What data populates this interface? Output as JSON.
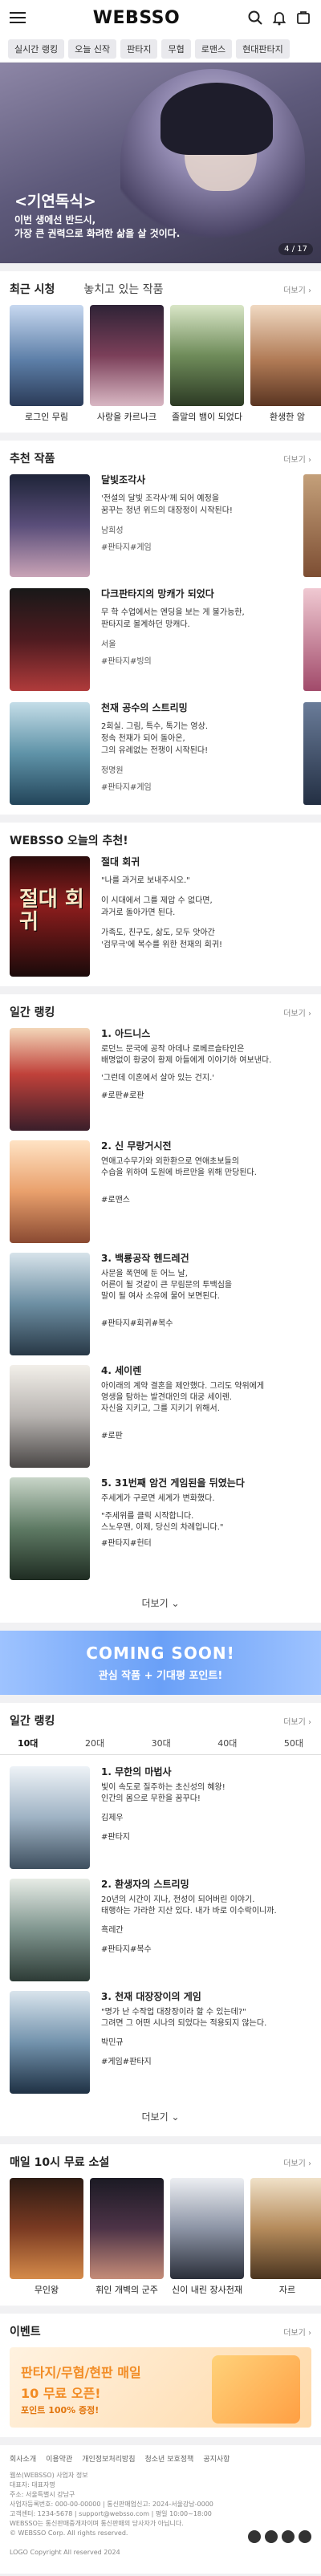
{
  "header": {
    "logo": "WEBSSO"
  },
  "categories": [
    "실시간 랭킹",
    "오늘 신작",
    "판타지",
    "무협",
    "로맨스",
    "현대판타지"
  ],
  "banner": {
    "title": "<기연독식>",
    "subtitle_line1": "이번 생에선 반드시,",
    "subtitle_line2": "가장 큰 권력으로 화려한 삶을 살 것이다.",
    "page": "4 / 17"
  },
  "recent": {
    "tab1": "최근 시청",
    "tab2": "놓치고 있는 작품",
    "more": "더보기 ›",
    "items": [
      "로그인 무림",
      "사랑을 카르나크",
      "졸말의 뱀이 되었다",
      "환생한 암"
    ]
  },
  "recommend": {
    "title": "추천 작품",
    "more": "더보기 ›",
    "items": [
      {
        "title": "달빛조각사",
        "desc": "'전설의 달빛 조각사'께 되어 예정을\n꿈꾸는 청년 위드의 대장정이 시작된다!",
        "author": "남희성",
        "tags": "#판타지#게임"
      },
      {
        "title": "다크판타지의 망캐가 되었다",
        "desc": "무 학 수업에서는 엔딩을 보는 게 불가능한,\n판타지로 볼계하던 망캐다.",
        "author": "서울",
        "tags": "#판타지#빙의"
      },
      {
        "title": "천재 공수의 스트리밍",
        "desc": "2회실. 그림, 특수, 톡기는 영상.\n정속 천재가 되어 돌아온,\n그의 유례없는 전쟁이 시작된다!",
        "author": "정명원",
        "tags": "#판타지#게임"
      }
    ]
  },
  "today": {
    "title": "WEBSSO 오늘의 추천!",
    "item": {
      "title": "절대 회귀",
      "l1": "\"나를 과거로 보내주시오.\"",
      "l2": "이 시대에서 그를 제압 수 없다면,",
      "l3": "과거로 돌아가면 된다.",
      "l4": "가족도, 친구도, 삶도, 모두 앗아간",
      "l5": "'검무극'에 복수를 위한 천재의 회귀!"
    }
  },
  "ranking": {
    "title": "일간 랭킹",
    "more": "더보기 ›",
    "more_button": "더보기",
    "items": [
      {
        "no": "1.",
        "title": "아드니스",
        "desc": "로던느 문국에 공작 아데나 로베르슬타인은\n배명없이 황궁이 황제 아들에게 이야기하 여보낸다.",
        "quote": "'그런데 이혼에서 살아 있는 건지.'",
        "tags": "#로판#로판"
      },
      {
        "no": "2.",
        "title": "신 무랑거시전",
        "desc": "연애고수무가와 외한환으로 연애초보들의\n수습을 위하여 도원에 바르만을 위해 만당된다.",
        "tags": "#로맨스"
      },
      {
        "no": "3.",
        "title": "백룡공작 헨드레건",
        "desc": "사문을 폭연에 둔 어느 날,\n어른이 될 것같이 큰 무림문의 투백심을\n말이 될 여사 소유에 물어 보면된다.",
        "tags": "#판타지#회귀#복수"
      },
      {
        "no": "4.",
        "title": "세이렌",
        "desc": "아이래의 계약 결혼을 제안했다. 그리도 약위에게\n영생을 탐하는 발견대인의 대궁 세이렌.\n자신을 지키고, 그를 지키기 위해서.",
        "tags": "#로판"
      },
      {
        "no": "5.",
        "title": "31번째 암건 게임된을 뒤였는다",
        "desc": "주세계가 구로면 세계가 변화했다.",
        "quote2": "\"주세위를 클릭 시작합니다.\n스노우맨, 이제, 당신의 차례입니다.\"",
        "tags": "#판타지#헌터"
      }
    ]
  },
  "coming": {
    "line1": "COMING SOON!",
    "line2": "관심 작품 + 기대평 포인트!"
  },
  "daily": {
    "title": "일간 랭킹",
    "more": "더보기 ›",
    "tabs": [
      "10대",
      "20대",
      "30대",
      "40대",
      "50대"
    ],
    "more_button": "더보기",
    "items": [
      {
        "no": "1.",
        "title": "무한의 마법사",
        "desc": "빛이 속도로 질주하는 초신성의 혜왕!\n인간의 몸으로 무한을 꿈꾸다!",
        "author": "김제우",
        "tags": "#판타지"
      },
      {
        "no": "2.",
        "title": "환생자의 스트리밍",
        "desc": "20년의 시간이 지나, 전성이 되어버린 이야기.\n태행하는 가라한 지산 있다. 내가 바로 이수락이니까.",
        "author": "흑레간",
        "tags": "#판타지#복수"
      },
      {
        "no": "3.",
        "title": "천재 대장장이의 게임",
        "desc": "\"명가 난 수작업 대장장이라 할 수 있는데?\"\n그려면 그 어떤 시나의 되었다는 적용되지 않는다.",
        "author": "박민규",
        "tags": "#게임#판타지"
      }
    ]
  },
  "free": {
    "title": "매일 10시 무료 소설",
    "more": "더보기 ›",
    "items": [
      "무인왕",
      "휘인 개벽의 군주",
      "신이 내린 장사천재",
      "자르"
    ]
  },
  "event": {
    "title": "이벤트",
    "more": "더보기 ›",
    "line1": "판타지/무협/현판 매일",
    "line2": "10 무료 오픈!",
    "line3": "포인트 100% 증정!"
  },
  "footer": {
    "links": [
      "회사소개",
      "이용약관",
      "개인정보처리방침",
      "청소년 보호정책",
      "공지사항"
    ],
    "lines": [
      "웹쏘(WEBSSO) 사업자 정보",
      "대표자: 대표자명",
      "주소: 서울특별시 강남구",
      "사업자등록번호: 000-00-00000 | 통신판매업신고: 2024-서울강남-0000",
      "고객센터: 1234-5678 | support@websso.com | 평일 10:00~18:00",
      "WEBSSO는 통신판매중개자이며 통신판매의 당사자가 아닙니다.",
      "© WEBSSO Corp. All rights reserved."
    ],
    "copyright": "LOGO Copyright All reserved 2024"
  },
  "colors": {
    "accent": "#6aa0f7",
    "event": "#f28b23"
  }
}
